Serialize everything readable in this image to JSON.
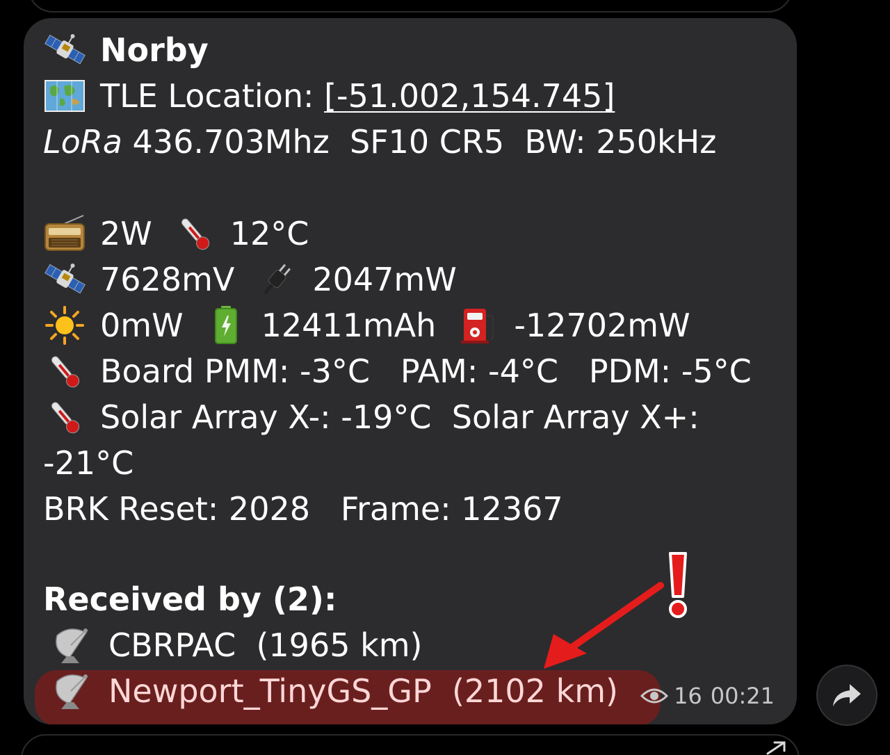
{
  "message": {
    "title": "Norby",
    "tle_label": "TLE Location: ",
    "tle_coords": "[-51.002,154.745]",
    "lora_label": "LoRa",
    "lora_details": " 436.703Mhz  SF10 CR5  BW: 250kHz",
    "power": "2W",
    "temp": "12°C",
    "voltage": "7628mV",
    "plug_power": "2047mW",
    "solar_power": "0mW",
    "battery": "12411mAh",
    "fuel_power": "-12702mW",
    "board_temps": "Board PMM: -3°C   PAM: -4°C   PDM: -5°C",
    "solar_array_temps": "Solar Array X-: -19°C  Solar Array X+:",
    "solar_array_temps_cont": "-21°C",
    "brk_frame": "BRK Reset: 2028   Frame: 12367",
    "received_by": "Received by (2):",
    "station1": "CBRPAC  (1965 km)",
    "station2": "Newport_TinyGS_GP  (2102 km)",
    "views": "16",
    "time": "00:21"
  },
  "colors": {
    "bubble_bg": "#2c2c2e",
    "highlight": "#6e1f1f",
    "annotation_red": "#e51c1c",
    "meta_text": "#c7c7c7"
  },
  "icons": {
    "satellite": "satellite-icon",
    "map": "world-map-icon",
    "radio": "radio-icon",
    "thermometer": "thermometer-icon",
    "plug": "electric-plug-icon",
    "sun": "sun-icon",
    "battery": "battery-icon",
    "fuel": "fuel-pump-icon",
    "dish": "satellite-dish-icon",
    "eye": "eye-icon",
    "share": "share-icon"
  }
}
